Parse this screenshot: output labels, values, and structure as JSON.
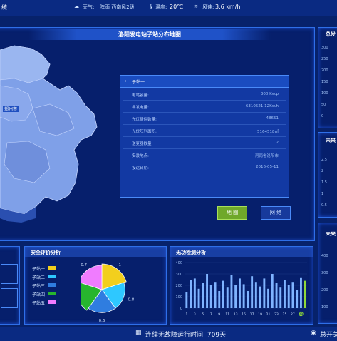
{
  "topbar": {
    "weather_label": "天气:",
    "weather_value": "阵雨 西南风2级",
    "temp_label": "温度:",
    "temp_value": "20℃",
    "wind_label": "风速:",
    "wind_value": "3.6 km/h",
    "left_fragment": "统"
  },
  "map_panel": {
    "title": "洛阳发电站子站分布地图",
    "city_label": "郑州市"
  },
  "info_box": {
    "title": "子站一",
    "rows": [
      {
        "k": "电站容量:",
        "v": "300 Kw.p"
      },
      {
        "k": "年发电量:",
        "v": "6310521.12Kw.h"
      },
      {
        "k": "光伏组件数量:",
        "v": "48651"
      },
      {
        "k": "光伏阵列面积:",
        "v": "5164518㎡"
      },
      {
        "k": "逆变器数量:",
        "v": "2"
      },
      {
        "k": "安装地点:",
        "v": "河南省洛阳市"
      },
      {
        "k": "投运日期:",
        "v": "2016-05-11"
      }
    ]
  },
  "buttons": {
    "map": "地 图",
    "network": "网 络"
  },
  "right_col": {
    "top_label": "总发",
    "mid_label": "未来",
    "bot_label": "未来",
    "ticks_a": [
      "300",
      "250",
      "200",
      "150",
      "100",
      "50",
      "0"
    ],
    "ticks_b": [
      "2.5",
      "2",
      "1.5",
      "1",
      "0.5"
    ],
    "ticks_c": [
      "400",
      "300",
      "200",
      "100"
    ]
  },
  "safety_panel": {
    "title": "安全评价分析",
    "legend": [
      {
        "label": "子站一",
        "color": "#f2cf1d"
      },
      {
        "label": "子站二",
        "color": "#2ec8ff"
      },
      {
        "label": "子站三",
        "color": "#2f7de0"
      },
      {
        "label": "子站四",
        "color": "#27b52e"
      },
      {
        "label": "子站五",
        "color": "#f07cff"
      }
    ]
  },
  "reactive_panel": {
    "title": "无功检测分析"
  },
  "chart_data": [
    {
      "type": "pie",
      "title": "安全评价分析",
      "categories": [
        "子站一",
        "子站二",
        "子站三",
        "子站四",
        "子站五"
      ],
      "values": [
        0.8,
        0.6,
        0.6,
        0.8,
        0.7
      ],
      "colors": [
        "#f2cf1d",
        "#2ec8ff",
        "#2f7de0",
        "#27b52e",
        "#f07cff"
      ],
      "labels": [
        "1",
        "0.8",
        "0.6",
        "0.8",
        "0.7"
      ]
    },
    {
      "type": "bar",
      "title": "无功检测分析",
      "categories": [
        "1",
        "3",
        "5",
        "7",
        "9",
        "11",
        "13",
        "15",
        "17",
        "19",
        "21",
        "23",
        "25",
        "27",
        "29"
      ],
      "values": [
        140,
        250,
        260,
        170,
        220,
        300,
        200,
        230,
        150,
        240,
        180,
        290,
        200,
        260,
        210,
        150,
        280,
        230,
        190,
        260,
        170,
        300,
        220,
        180,
        250,
        200,
        230,
        160,
        270,
        240
      ],
      "ylim": [
        0,
        400
      ],
      "yticks": [
        "400",
        "300",
        "200",
        "100",
        "0"
      ]
    }
  ],
  "footer": {
    "status": "连续无故障运行时间: 709天",
    "right": "总开关"
  }
}
